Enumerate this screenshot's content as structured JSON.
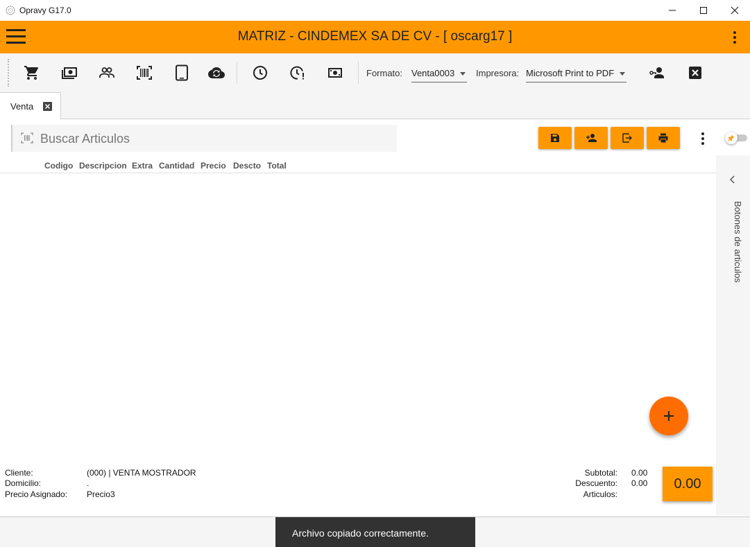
{
  "window": {
    "title": "Opravy G17.0"
  },
  "header": {
    "title": "MATRIZ - CINDEMEX SA DE CV - [ oscarg17 ]"
  },
  "toolbar": {
    "icons": [
      "cart-icon",
      "cash-icon",
      "users-icon",
      "barcode-icon",
      "tablet-icon",
      "cloud-sync-icon",
      "clock-icon",
      "clock-alert-icon",
      "money-icon"
    ],
    "formato_label": "Formato:",
    "formato_value": "Venta0003",
    "impresora_label": "Impresora:",
    "impresora_value": "Microsoft Print to PDF"
  },
  "tabs": [
    {
      "label": "Venta"
    }
  ],
  "search": {
    "placeholder": "Buscar Articulos"
  },
  "table": {
    "columns": [
      "Codigo",
      "Descripcion",
      "Extra",
      "Cantidad",
      "Precio",
      "Descto",
      "Total"
    ],
    "rows": []
  },
  "side_panel": {
    "label": "Botones de articulos"
  },
  "customer": {
    "cliente_label": "Cliente:",
    "cliente_value": "(000) | VENTA MOSTRADOR",
    "domicilio_label": "Domicilio:",
    "domicilio_value": ".",
    "precio_label": "Precio Asignado:",
    "precio_value": "Precio3"
  },
  "totals": {
    "subtotal_label": "Subtotal:",
    "subtotal_value": "0.00",
    "descuento_label": "Descuento:",
    "descuento_value": "0.00",
    "articulos_label": "Articulos:",
    "articulos_value": "",
    "total": "0.00"
  },
  "snackbar": {
    "message": "Archivo copiado correctamente."
  },
  "colors": {
    "accent": "#ff9800",
    "fab": "#ff6d00",
    "snackbar": "#323232"
  }
}
